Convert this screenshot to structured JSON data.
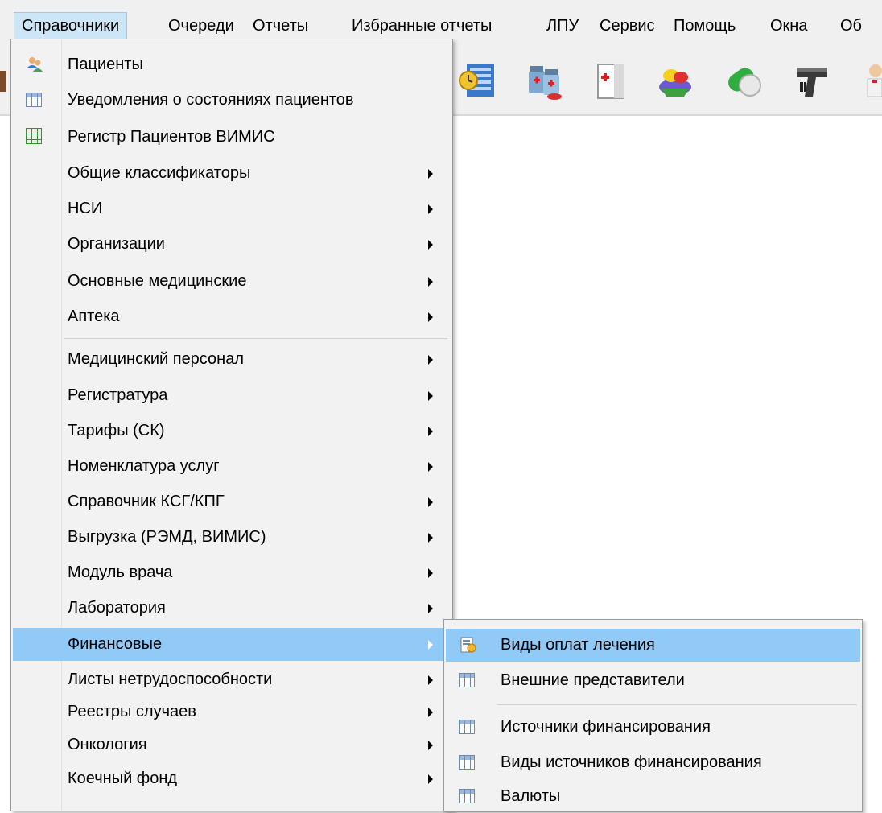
{
  "menubar": {
    "items": [
      {
        "label": "Справочники",
        "active": true
      },
      {
        "label": "Очереди"
      },
      {
        "label": "Отчеты"
      },
      {
        "label": "Избранные отчеты"
      },
      {
        "label": "ЛПУ"
      },
      {
        "label": "Сервис"
      },
      {
        "label": "Помощь"
      },
      {
        "label": "Окна"
      },
      {
        "label": "Об"
      }
    ]
  },
  "toolbar": {
    "icons": [
      "schedule-book-icon",
      "medicine-vials-icon",
      "medical-folder-icon",
      "pills-basket-icon",
      "capsule-tablet-icon",
      "barcode-scanner-icon",
      "doctor-icon"
    ]
  },
  "menu": {
    "items": [
      {
        "label": "Пациенты",
        "icon": "patients-icon",
        "submenu": false
      },
      {
        "label": "Уведомления о состояниях пациентов",
        "icon": "grid-icon",
        "submenu": false
      },
      {
        "label": "Регистр Пациентов ВИМИС",
        "icon": "green-grid-icon",
        "submenu": false
      },
      {
        "label": "Общие классификаторы",
        "submenu": true
      },
      {
        "label": "НСИ",
        "submenu": true
      },
      {
        "label": "Организации",
        "submenu": true
      },
      {
        "label": "Основные медицинские",
        "submenu": true
      },
      {
        "label": "Аптека",
        "submenu": true
      },
      {
        "label": "Медицинский персонал",
        "submenu": true
      },
      {
        "label": "Регистратура",
        "submenu": true
      },
      {
        "label": "Тарифы (СК)",
        "submenu": true
      },
      {
        "label": "Номенклатура услуг",
        "submenu": true
      },
      {
        "label": "Справочник КСГ/КПГ",
        "submenu": true
      },
      {
        "label": "Выгрузка (РЭМД, ВИМИС)",
        "submenu": true
      },
      {
        "label": "Модуль врача",
        "submenu": true
      },
      {
        "label": "Лаборатория",
        "submenu": true
      },
      {
        "label": "Финансовые",
        "submenu": true,
        "highlighted": true
      },
      {
        "label": "Листы нетрудоспособности",
        "submenu": true
      },
      {
        "label": "Реестры случаев",
        "submenu": true
      },
      {
        "label": "Онкология",
        "submenu": true
      },
      {
        "label": "Коечный фонд",
        "submenu": true
      }
    ]
  },
  "submenu": {
    "items": [
      {
        "label": "Виды оплат лечения",
        "icon": "payment-types-icon",
        "highlighted": true
      },
      {
        "label": "Внешние представители",
        "icon": "grid-icon"
      },
      {
        "label": "Источники финансирования",
        "icon": "grid-icon"
      },
      {
        "label": "Виды источников финансирования",
        "icon": "grid-icon"
      },
      {
        "label": "Валюты",
        "icon": "grid-icon"
      }
    ]
  },
  "colors": {
    "highlight": "#91c9f7",
    "menubar_active": "#cde6f7",
    "menu_bg": "#f2f2f2"
  }
}
